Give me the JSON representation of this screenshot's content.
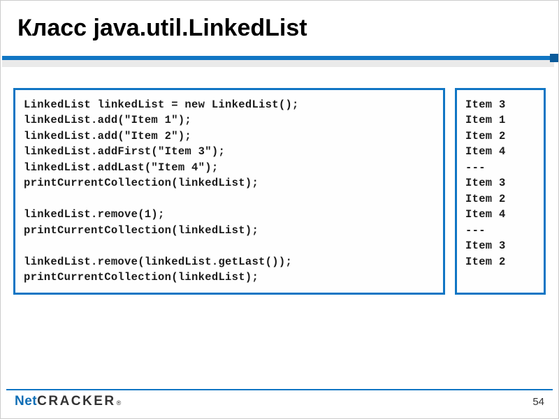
{
  "slide": {
    "title": "Класс java.util.LinkedList",
    "code_left": "LinkedList linkedList = new LinkedList();\nlinkedList.add(\"Item 1\");\nlinkedList.add(\"Item 2\");\nlinkedList.addFirst(\"Item 3\");\nlinkedList.addLast(\"Item 4\");\nprintCurrentCollection(linkedList);\n\nlinkedList.remove(1);\nprintCurrentCollection(linkedList);\n\nlinkedList.remove(linkedList.getLast());\nprintCurrentCollection(linkedList);",
    "code_right": "Item 3\nItem 1\nItem 2\nItem 4\n---\nItem 3\nItem 2\nItem 4\n---\nItem 3\nItem 2"
  },
  "footer": {
    "logo_part1": "Net",
    "logo_part2": "CRACKER",
    "logo_trademark": "®",
    "page_number": "54"
  },
  "colors": {
    "accent": "#1176c4",
    "text": "#1a1a1a"
  }
}
